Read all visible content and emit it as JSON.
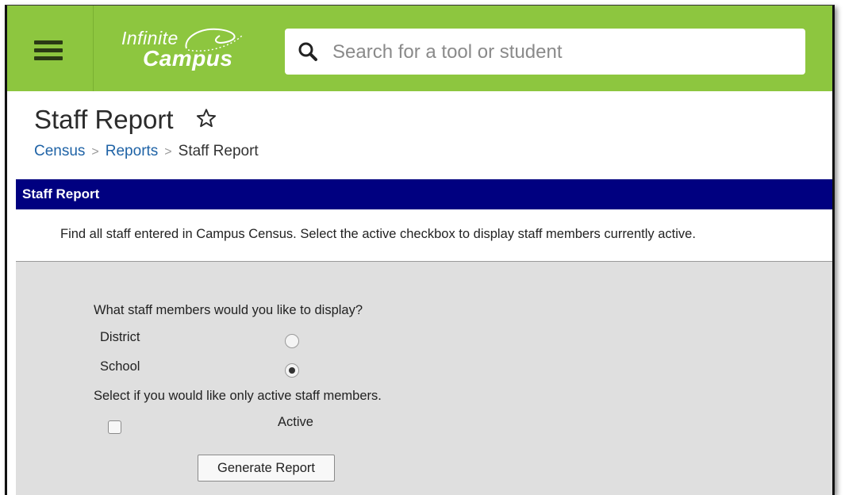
{
  "header": {
    "logo_line1": "Infinite",
    "logo_line2": "Campus",
    "search_placeholder": "Search for a tool or student",
    "accent_color": "#8dc63f"
  },
  "page": {
    "title": "Staff Report",
    "breadcrumb": [
      "Census",
      "Reports",
      "Staff Report"
    ]
  },
  "panel": {
    "title": "Staff Report",
    "header_color": "#000080",
    "description": "Find all staff entered in Campus Census. Select the active checkbox to display staff members currently active."
  },
  "form": {
    "display_question": "What staff members would you like to display?",
    "options": [
      {
        "label": "District",
        "checked": false
      },
      {
        "label": "School",
        "checked": true
      }
    ],
    "active_prompt": "Select if you would like only active staff members.",
    "active_label": "Active",
    "active_checked": false,
    "generate_button": "Generate Report"
  },
  "icons": [
    "hamburger-menu-icon",
    "search-icon",
    "star-outline-icon",
    "chevron-right-icon"
  ]
}
